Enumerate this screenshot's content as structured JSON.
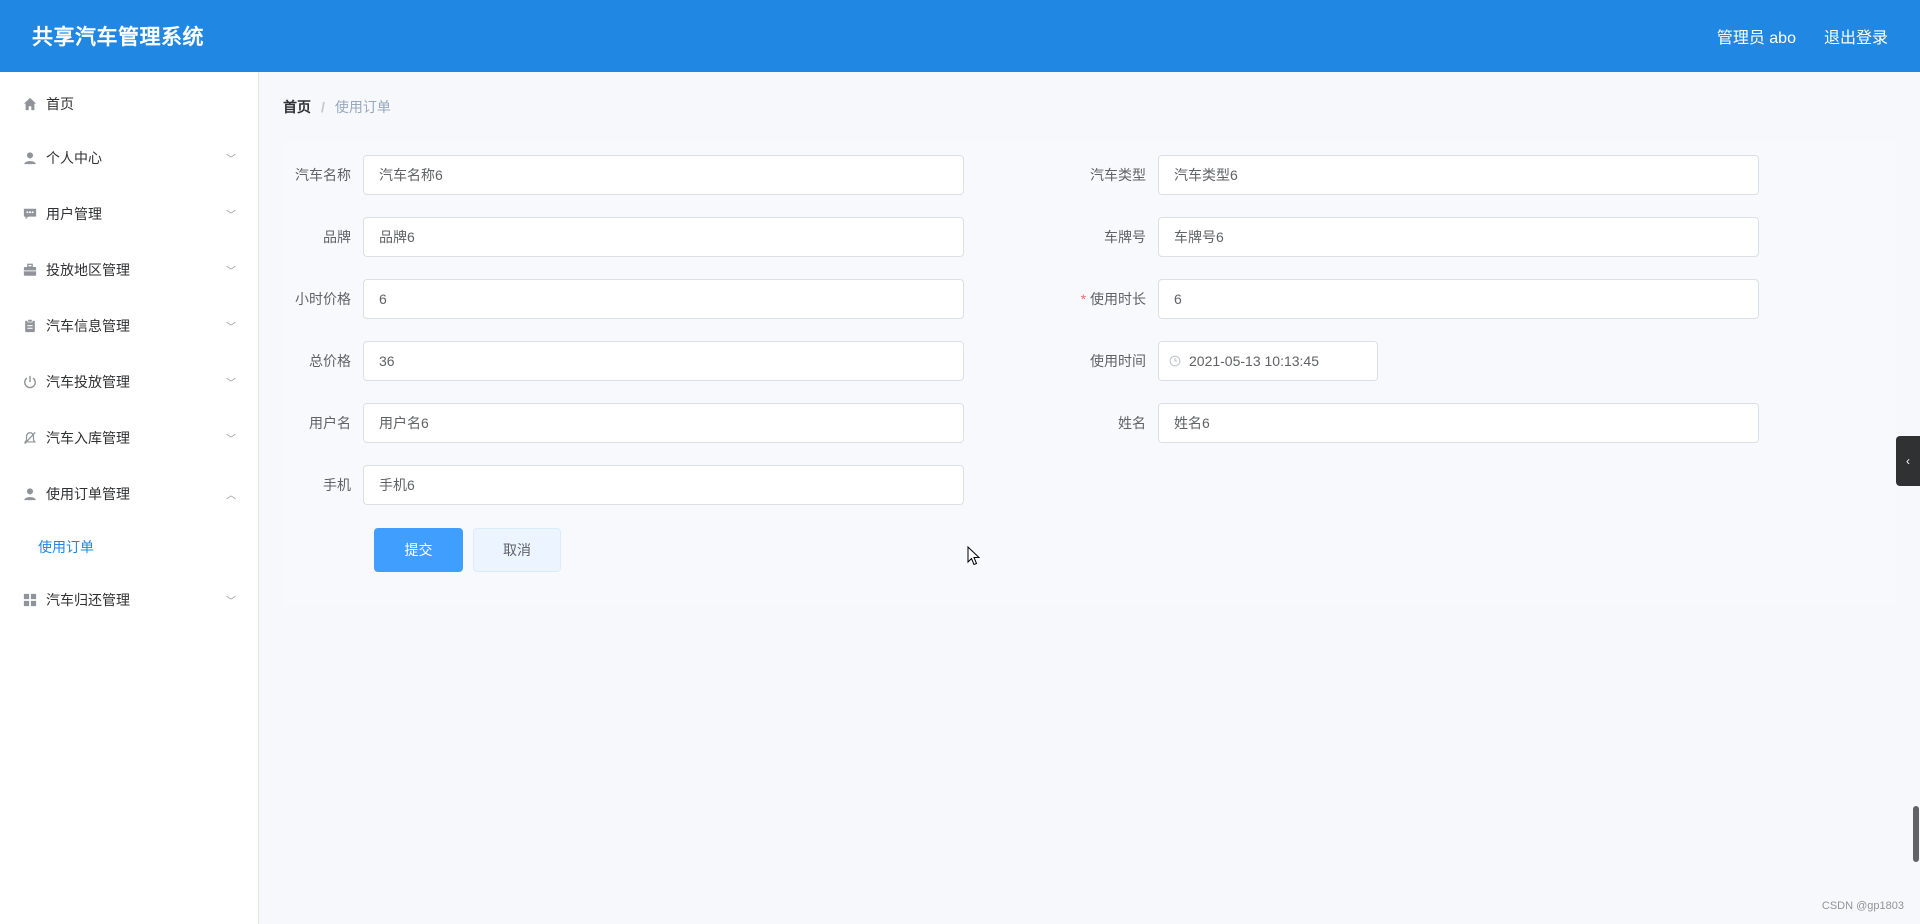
{
  "header": {
    "title": "共享汽车管理系统",
    "user_label": "管理员 abo",
    "logout_label": "退出登录"
  },
  "sidebar": {
    "items": [
      {
        "label": "首页",
        "icon": "home-icon"
      },
      {
        "label": "个人中心",
        "icon": "user-icon"
      },
      {
        "label": "用户管理",
        "icon": "chat-icon"
      },
      {
        "label": "投放地区管理",
        "icon": "briefcase-icon"
      },
      {
        "label": "汽车信息管理",
        "icon": "clipboard-icon"
      },
      {
        "label": "汽车投放管理",
        "icon": "power-icon"
      },
      {
        "label": "汽车入库管理",
        "icon": "bell-off-icon"
      },
      {
        "label": "使用订单管理",
        "icon": "user-icon"
      },
      {
        "label": "汽车归还管理",
        "icon": "grid-icon"
      }
    ],
    "active_sub_item": "使用订单"
  },
  "breadcrumb": {
    "home": "首页",
    "separator": "/",
    "current": "使用订单"
  },
  "form": {
    "car_name": {
      "label": "汽车名称",
      "value": "汽车名称6"
    },
    "car_type": {
      "label": "汽车类型",
      "value": "汽车类型6"
    },
    "brand": {
      "label": "品牌",
      "value": "品牌6"
    },
    "plate": {
      "label": "车牌号",
      "value": "车牌号6"
    },
    "hourly_price": {
      "label": "小时价格",
      "value": "6"
    },
    "duration": {
      "label": "使用时长",
      "value": "6",
      "required": true
    },
    "total_price": {
      "label": "总价格",
      "value": "36"
    },
    "use_time": {
      "label": "使用时间",
      "value": "2021-05-13 10:13:45"
    },
    "username": {
      "label": "用户名",
      "value": "用户名6"
    },
    "name": {
      "label": "姓名",
      "value": "姓名6"
    },
    "phone": {
      "label": "手机",
      "value": "手机6"
    }
  },
  "buttons": {
    "submit": "提交",
    "cancel": "取消"
  },
  "watermark": "CSDN @gp1803",
  "colors": {
    "header": "#2087e2",
    "primary": "#409eff",
    "active_menu": "#2087e2",
    "required": "#f56c6c"
  }
}
